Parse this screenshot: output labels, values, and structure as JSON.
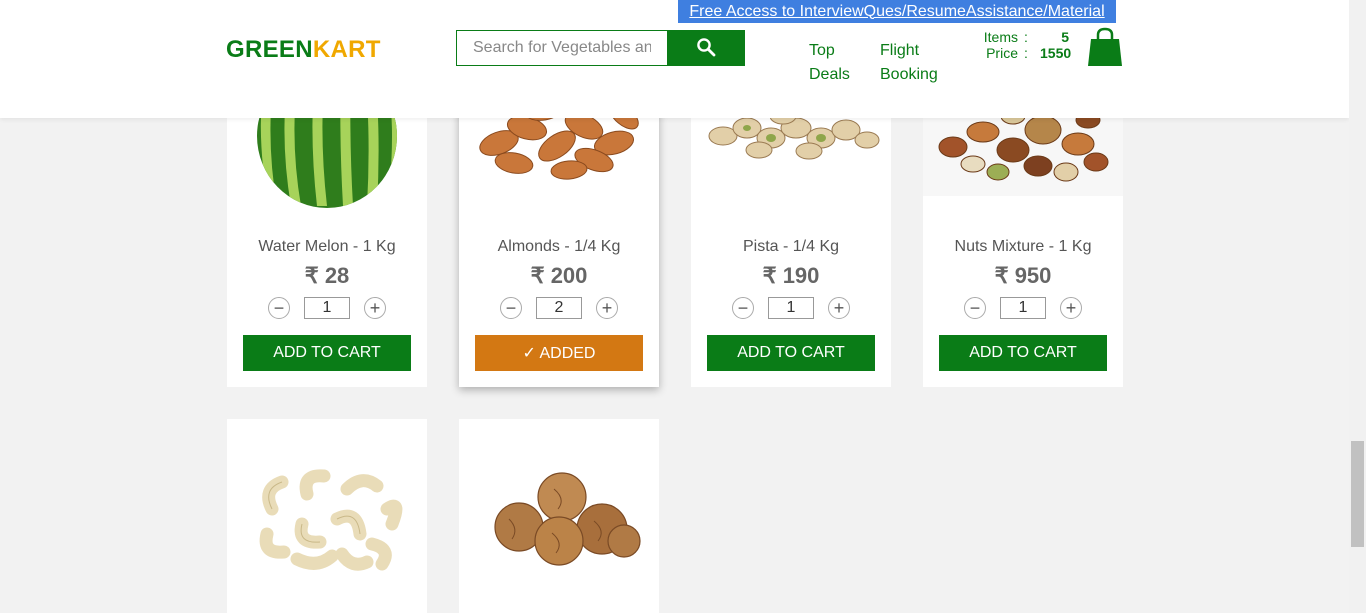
{
  "header": {
    "logo": {
      "part1": "GREEN",
      "part2": "KART"
    },
    "search": {
      "placeholder": "Search for Vegetables and Fruits",
      "value": ""
    },
    "promo_link": "Free Access to InterviewQues/ResumeAssistance/Material",
    "nav": [
      {
        "line1": "Top",
        "line2": "Deals"
      },
      {
        "line1": "Flight",
        "line2": "Booking"
      }
    ],
    "cart_summary": {
      "items_label": "Items",
      "items_value": "5",
      "price_label": "Price",
      "price_value": "1550",
      "colon": ":"
    }
  },
  "products": [
    {
      "name": "Water Melon - 1 Kg",
      "price": "₹ 28",
      "qty": "1",
      "button": "ADD TO CART",
      "state": "default",
      "icon": "watermelon"
    },
    {
      "name": "Almonds - 1/4 Kg",
      "price": "₹ 200",
      "qty": "2",
      "button": "✓ ADDED",
      "state": "added",
      "icon": "almonds"
    },
    {
      "name": "Pista - 1/4 Kg",
      "price": "₹ 190",
      "qty": "1",
      "button": "ADD TO CART",
      "state": "default",
      "icon": "pistachios"
    },
    {
      "name": "Nuts Mixture - 1 Kg",
      "price": "₹ 950",
      "qty": "1",
      "button": "ADD TO CART",
      "state": "default",
      "icon": "mixed-nuts"
    },
    {
      "icon": "cashews"
    },
    {
      "icon": "walnuts"
    }
  ],
  "stepper": {
    "minus": "−",
    "plus": "+"
  },
  "colors": {
    "brand_green": "#0a7c17",
    "logo_orange": "#f0a800",
    "added_orange": "#d37813",
    "promo_blue": "#3f7fe0"
  }
}
